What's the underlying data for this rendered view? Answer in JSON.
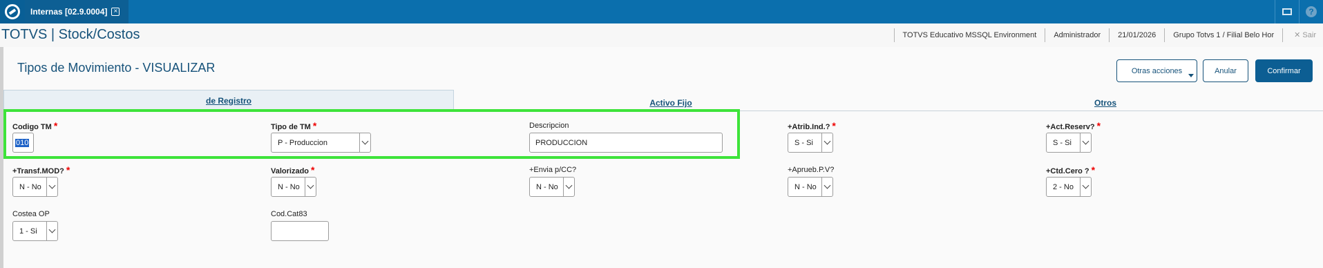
{
  "topbar": {
    "tab_label": "Internas [02.9.0004]",
    "tab_close": "×",
    "icons": [
      "mail-icon",
      "help-icon"
    ],
    "help_glyph": "?"
  },
  "header": {
    "brand": "TOTVS | Stock/Costos",
    "environment": "TOTVS Educativo MSSQL Environment",
    "user": "Administrador",
    "date": "21/01/2026",
    "branch": "Grupo Totvs 1 / Filial Belo Hor",
    "exit_label": "✕  Sair"
  },
  "page": {
    "title": "Tipos de Movimiento - VISUALIZAR",
    "actions": {
      "other": "Otras acciones",
      "cancel": "Anular",
      "confirm": "Confirmar"
    }
  },
  "folder_tabs": [
    {
      "label": "de Registro",
      "active": true
    },
    {
      "label": "Activo Fijo",
      "active": false
    },
    {
      "label": "Otros",
      "active": false
    }
  ],
  "fields": {
    "codigo_tm": {
      "label": "Codigo TM",
      "required": "*",
      "value": "010"
    },
    "tipo_tm": {
      "label": "Tipo de TM",
      "required": "*",
      "value": "P - Produccion"
    },
    "descripcion": {
      "label": "Descripcion",
      "value": "PRODUCCION"
    },
    "atrib_ind": {
      "label": "+Atrib.Ind.?",
      "required": "*",
      "value": "S - Si"
    },
    "act_reserv": {
      "label": "+Act.Reserv?",
      "required": "*",
      "value": "S - Si"
    },
    "transf_mod": {
      "label": "+Transf.MOD?",
      "required": "*",
      "value": "N - No"
    },
    "valorizado": {
      "label": "Valorizado",
      "required": "*",
      "value": "N - No"
    },
    "envia_pcc": {
      "label": "+Envia p/CC?",
      "value": "N - No"
    },
    "aprueb_pv": {
      "label": "+Aprueb.P.V?",
      "value": "N - No"
    },
    "ctd_cero": {
      "label": "+Ctd.Cero  ?",
      "required": "*",
      "value": "2 - No"
    },
    "costea_op": {
      "label": "Costea OP",
      "value": "1 - Si"
    },
    "cod_cat83": {
      "label": "Cod.Cat83",
      "value": ""
    }
  }
}
